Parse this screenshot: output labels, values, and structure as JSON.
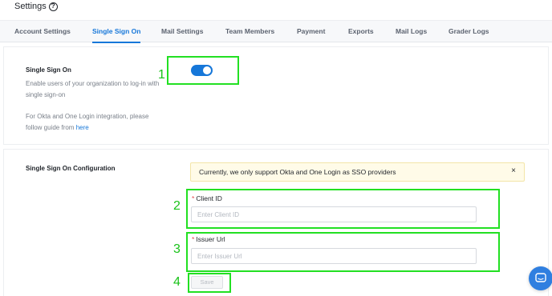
{
  "header": {
    "title": "Settings",
    "help_icon": "?"
  },
  "tabs": [
    {
      "label": "Account Settings",
      "active": false
    },
    {
      "label": "Single Sign On",
      "active": true
    },
    {
      "label": "Mail Settings",
      "active": false
    },
    {
      "label": "Team Members",
      "active": false
    },
    {
      "label": "Payment",
      "active": false
    },
    {
      "label": "Exports",
      "active": false
    },
    {
      "label": "Mail Logs",
      "active": false
    },
    {
      "label": "Grader Logs",
      "active": false
    }
  ],
  "sso": {
    "title": "Single Sign On",
    "description": "Enable users of your organization to log-in with single sign-on",
    "guide_text": "For Okta and One Login integration, please follow guide from",
    "guide_link": "here",
    "enabled": true
  },
  "config": {
    "title": "Single Sign On Configuration",
    "alert": "Currently, we only support Okta and One Login as SSO providers",
    "alert_close": "×",
    "client_id": {
      "label": "Client ID",
      "required_mark": "*",
      "placeholder": "Enter Client ID",
      "value": ""
    },
    "issuer_url": {
      "label": "Issuer Url",
      "required_mark": "*",
      "placeholder": "Enter Issuer Url",
      "value": ""
    },
    "save_label": "Save"
  },
  "annotations": [
    "1",
    "2",
    "3",
    "4"
  ],
  "colors": {
    "accent": "#1677d9",
    "highlight": "#22e022",
    "annotation": "#19c219",
    "required": "#e5484d",
    "alert_bg": "#fffbe8",
    "chat": "#2f7fe0"
  },
  "icons": {
    "help": "help-circle-icon",
    "close": "close-icon",
    "chat": "chat-icon"
  }
}
